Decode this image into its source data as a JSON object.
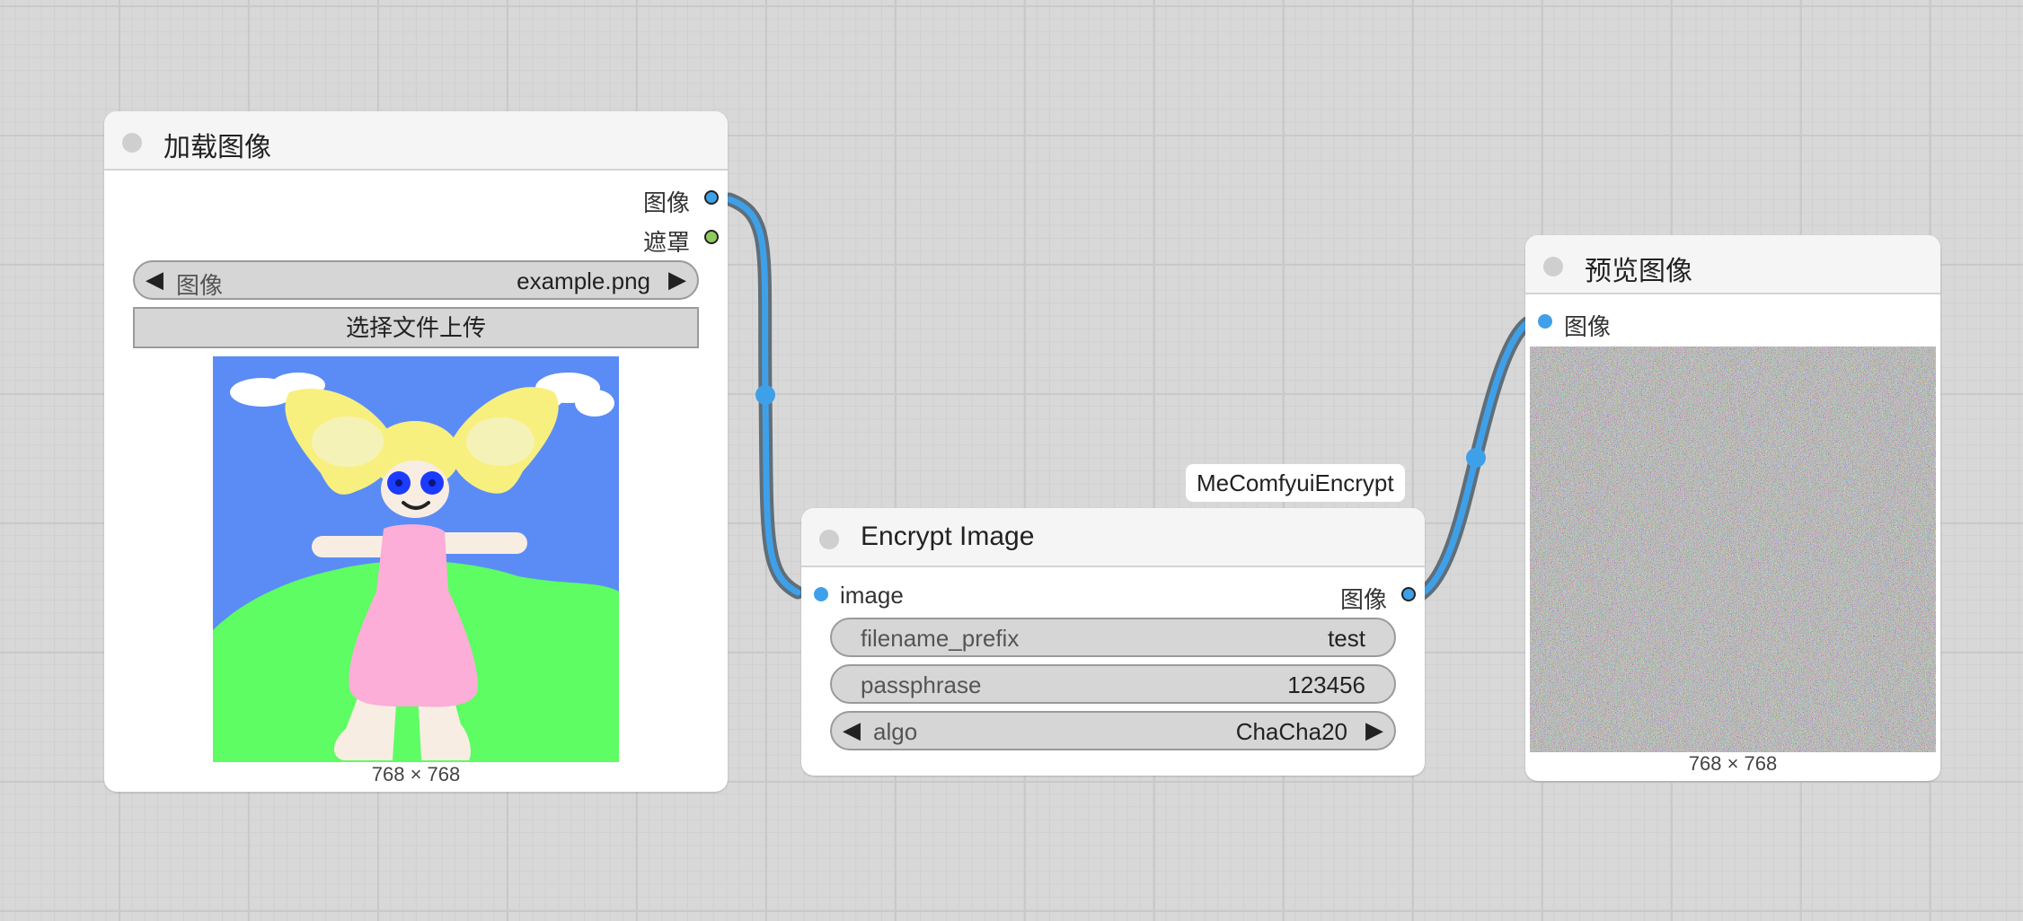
{
  "colors": {
    "canvas_bg": "#d8d8d8",
    "image_slot": "#3fa0ea",
    "mask_slot": "#8fcc5c",
    "link_outer": "#5f6e78",
    "link_inner": "#3fa0ea"
  },
  "load_image_node": {
    "title": "加载图像",
    "outputs": [
      {
        "label": "图像",
        "type": "image",
        "color": "#3fa0ea"
      },
      {
        "label": "遮罩",
        "type": "mask",
        "color": "#8fcc5c"
      }
    ],
    "image_widget": {
      "label": "图像",
      "value": "example.png"
    },
    "upload_button": "选择文件上传",
    "preview_description": "drawing of a blonde girl in a pink dress on green grass under a blue sky",
    "dimensions": "768 × 768"
  },
  "encrypt_node": {
    "badge": "MeComfyuiEncrypt",
    "title": "Encrypt Image",
    "input_label": "image",
    "output_label": "图像",
    "widgets": {
      "filename_prefix": {
        "label": "filename_prefix",
        "value": "test"
      },
      "passphrase": {
        "label": "passphrase",
        "value": "123456"
      },
      "algo": {
        "label": "algo",
        "value": "ChaCha20"
      }
    }
  },
  "preview_node": {
    "title": "预览图像",
    "input_label": "图像",
    "preview_description": "encrypted image shown as random color noise",
    "dimensions": "768 × 768"
  }
}
